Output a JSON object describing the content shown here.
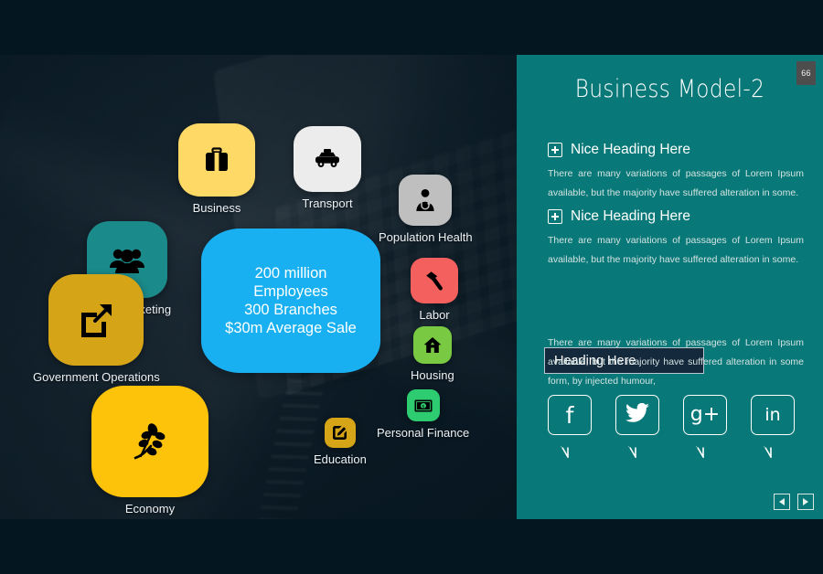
{
  "slide": {
    "badge": "66",
    "panel_title": "Business Model-2",
    "teal": "#097878",
    "dark_navy": "#04161f",
    "hub_blue": "#18b0f0"
  },
  "hub": {
    "lines": [
      "200 million",
      "Employees",
      "300 Branches",
      "$30m Average Sale"
    ]
  },
  "nodes": [
    {
      "label": "Social Marketing",
      "icon": "people-icon",
      "color": "#1b8a8a",
      "icon_color": "#000000"
    },
    {
      "label": "Business",
      "icon": "briefcase-icon",
      "color": "#ffd966",
      "icon_color": "#000000"
    },
    {
      "label": "Transport",
      "icon": "taxi-icon",
      "color": "#ececec",
      "icon_color": "#000000"
    },
    {
      "label": "Population Health",
      "icon": "doctor-icon",
      "color": "#bfbfbf",
      "icon_color": "#000000"
    },
    {
      "label": "Government Operations",
      "icon": "external-link-icon",
      "color": "#d6a417",
      "icon_color": "#000000"
    },
    {
      "label": "Labor",
      "icon": "hammer-icon",
      "color": "#f4605e",
      "icon_color": "#000000"
    },
    {
      "label": "Housing",
      "icon": "house-icon",
      "color": "#7ac943",
      "icon_color": "#000000"
    },
    {
      "label": "Economy",
      "icon": "leaf-branch-icon",
      "color": "#fdc20a",
      "icon_color": "#000000"
    },
    {
      "label": "Education",
      "icon": "pencil-edit-icon",
      "color": "#d6a417",
      "icon_color": "#000000"
    },
    {
      "label": "Personal Finance",
      "icon": "banknote-icon",
      "color": "#2ecc71",
      "icon_color": "#000000"
    }
  ],
  "sections": [
    {
      "heading": "Nice Heading Here",
      "body": "There are many variations of passages of Lorem Ipsum available, but the majority have suffered alteration in some."
    },
    {
      "heading": "Nice Heading Here",
      "body": "There are many variations of passages of Lorem Ipsum available, but the majority have suffered alteration in some."
    }
  ],
  "highlight": {
    "heading": "Heading Here",
    "body": "There are many variations of passages of Lorem Ipsum available, but the majority have suffered alteration in some form, by injected humour,"
  },
  "social": [
    {
      "name": "facebook",
      "glyph": "f"
    },
    {
      "name": "twitter",
      "glyph": "❧"
    },
    {
      "name": "google-plus",
      "glyph": "g+"
    },
    {
      "name": "linkedin",
      "glyph": "in"
    }
  ],
  "nav": {
    "prev": "◀",
    "next": "▶"
  }
}
